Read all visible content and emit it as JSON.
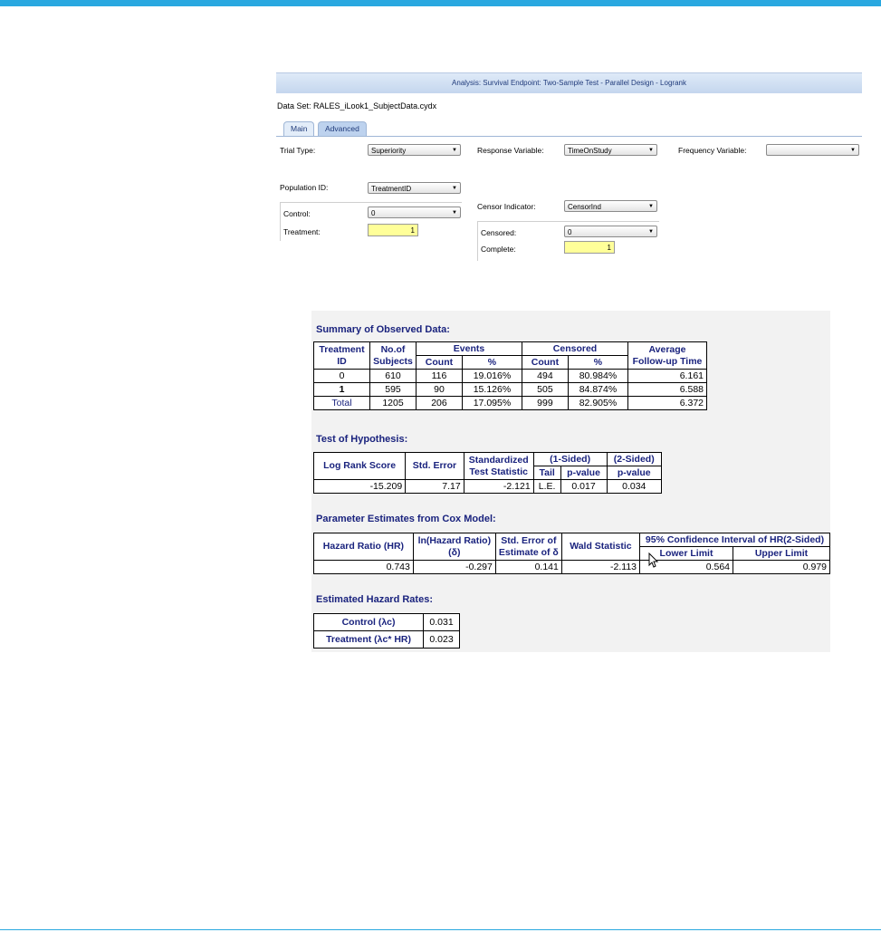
{
  "dialog": {
    "title": "Analysis: Survival Endpoint: Two-Sample Test - Parallel Design - Logrank",
    "dataset": "Data Set: RALES_iLook1_SubjectData.cydx",
    "tabs": [
      "Main",
      "Advanced"
    ],
    "trial_type": {
      "label": "Trial Type:",
      "value": "Superiority"
    },
    "response_variable": {
      "label": "Response Variable:",
      "value": "TimeOnStudy"
    },
    "frequency_variable": {
      "label": "Frequency Variable:",
      "value": ""
    },
    "population_id": {
      "label": "Population ID:",
      "value": "TreatmentID"
    },
    "control": {
      "label": "Control:",
      "value": "0"
    },
    "treatment": {
      "label": "Treatment:",
      "value": "1"
    },
    "censor_indicator": {
      "label": "Censor Indicator:",
      "value": "CensorInd"
    },
    "censored": {
      "label": "Censored:",
      "value": "0"
    },
    "complete": {
      "label": "Complete:",
      "value": "1"
    }
  },
  "summary": {
    "heading": "Summary of Observed Data:",
    "h_treatment_id": "Treatment ID",
    "h_no_subjects": "No.of Subjects",
    "h_events": "Events",
    "h_censored": "Censored",
    "h_avg_followup": "Average Follow-up Time",
    "h_count": "Count",
    "h_pct": "%",
    "rows": [
      {
        "id": "0",
        "n": "610",
        "ev_count": "116",
        "ev_pct": "19.016%",
        "ce_count": "494",
        "ce_pct": "80.984%",
        "avg": "6.161"
      },
      {
        "id": "1",
        "n": "595",
        "ev_count": "90",
        "ev_pct": "15.126%",
        "ce_count": "505",
        "ce_pct": "84.874%",
        "avg": "6.588"
      },
      {
        "id": "Total",
        "n": "1205",
        "ev_count": "206",
        "ev_pct": "17.095%",
        "ce_count": "999",
        "ce_pct": "82.905%",
        "avg": "6.372"
      }
    ]
  },
  "hypothesis": {
    "heading": "Test of Hypothesis:",
    "h_lrs": "Log Rank Score",
    "h_se": "Std. Error",
    "h_std": "Standardized Test Statistic",
    "h_one": "(1-Sided)",
    "h_two": "(2-Sided)",
    "h_tail": "Tail",
    "h_pv": "p-value",
    "values": {
      "lrs": "-15.209",
      "se": "7.17",
      "std": "-2.121",
      "tail": "L.E.",
      "p1": "0.017",
      "p2": "0.034"
    }
  },
  "cox": {
    "heading": "Parameter Estimates from Cox Model:",
    "h_hr": "Hazard Ratio (HR)",
    "h_ln": "ln(Hazard Ratio) (δ)",
    "h_se": "Std. Error of Estimate of δ",
    "h_wald": "Wald Statistic",
    "h_ci": "95% Confidence Interval of HR(2-Sided)",
    "h_lower": "Lower Limit",
    "h_upper": "Upper Limit",
    "values": {
      "hr": "0.743",
      "ln": "-0.297",
      "se": "0.141",
      "wald": "-2.113",
      "lower": "0.564",
      "upper": "0.979"
    }
  },
  "rates": {
    "heading": "Estimated Hazard Rates:",
    "control_label": "Control (λc)",
    "control_value": "0.031",
    "treatment_label": "Treatment (λc* HR)",
    "treatment_value": "0.023"
  }
}
